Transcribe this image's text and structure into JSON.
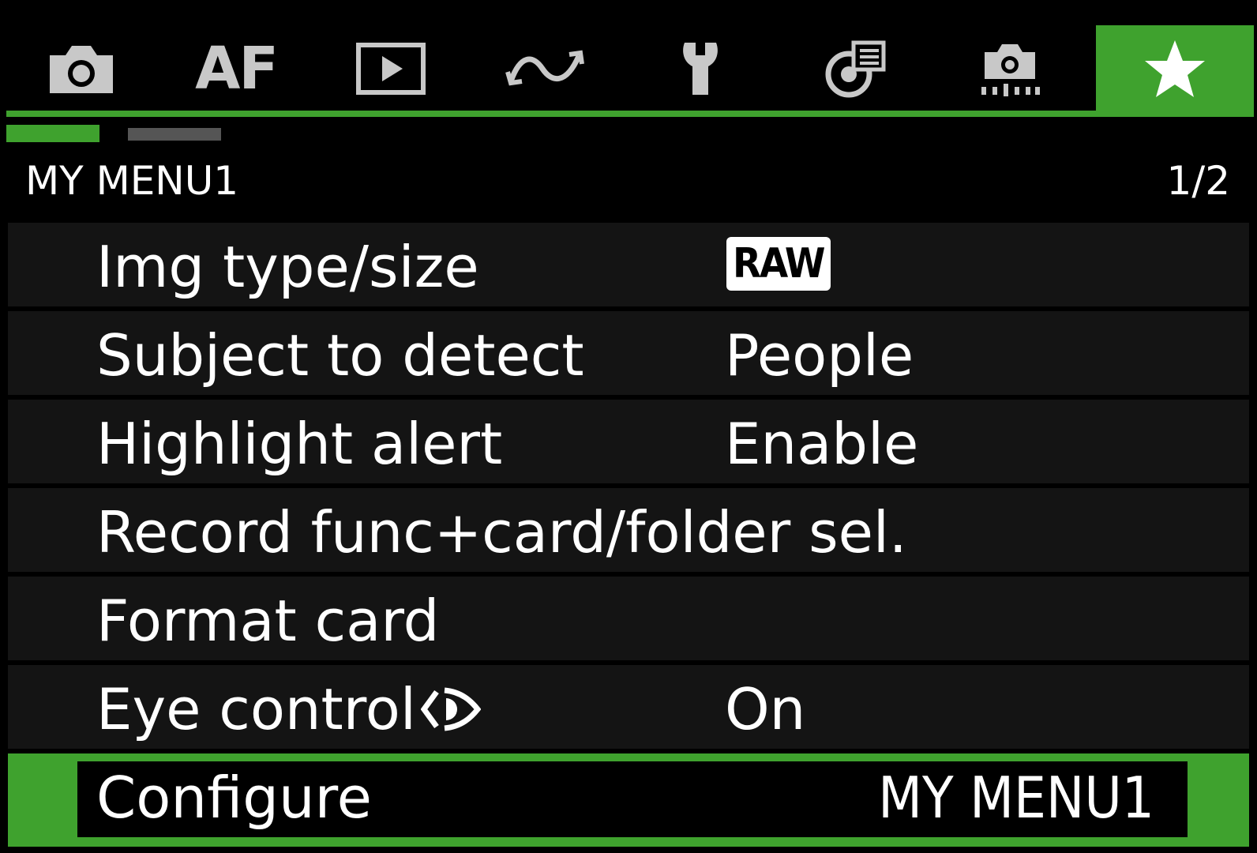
{
  "tabs": [
    {
      "icon": "camera-icon",
      "active": false
    },
    {
      "icon": "af-icon",
      "label": "AF",
      "active": false
    },
    {
      "icon": "playback-icon",
      "active": false
    },
    {
      "icon": "wireless-icon",
      "active": false
    },
    {
      "icon": "wrench-icon",
      "active": false
    },
    {
      "icon": "custom-functions-icon",
      "active": false
    },
    {
      "icon": "video-camera-icon",
      "active": false
    },
    {
      "icon": "star-icon",
      "active": true
    }
  ],
  "header": {
    "title": "MY MENU1",
    "page": "1/2"
  },
  "menu": [
    {
      "label": "Img type/size",
      "value": "RAW",
      "value_style": "badge"
    },
    {
      "label": "Subject to detect",
      "value": "People"
    },
    {
      "label": "Highlight alert",
      "value": "Enable"
    },
    {
      "label": "Record func+card/folder sel.",
      "value": ""
    },
    {
      "label": "Format card",
      "value": ""
    },
    {
      "label": "Eye control",
      "value": "On",
      "icon": "eye-icon"
    },
    {
      "label": "Configure",
      "value": "MY MENU1",
      "selected": true
    }
  ],
  "colors": {
    "accent": "#3fa22e",
    "background": "#000000",
    "row": "#141414",
    "inactive_tab": "#c8c8c8"
  }
}
